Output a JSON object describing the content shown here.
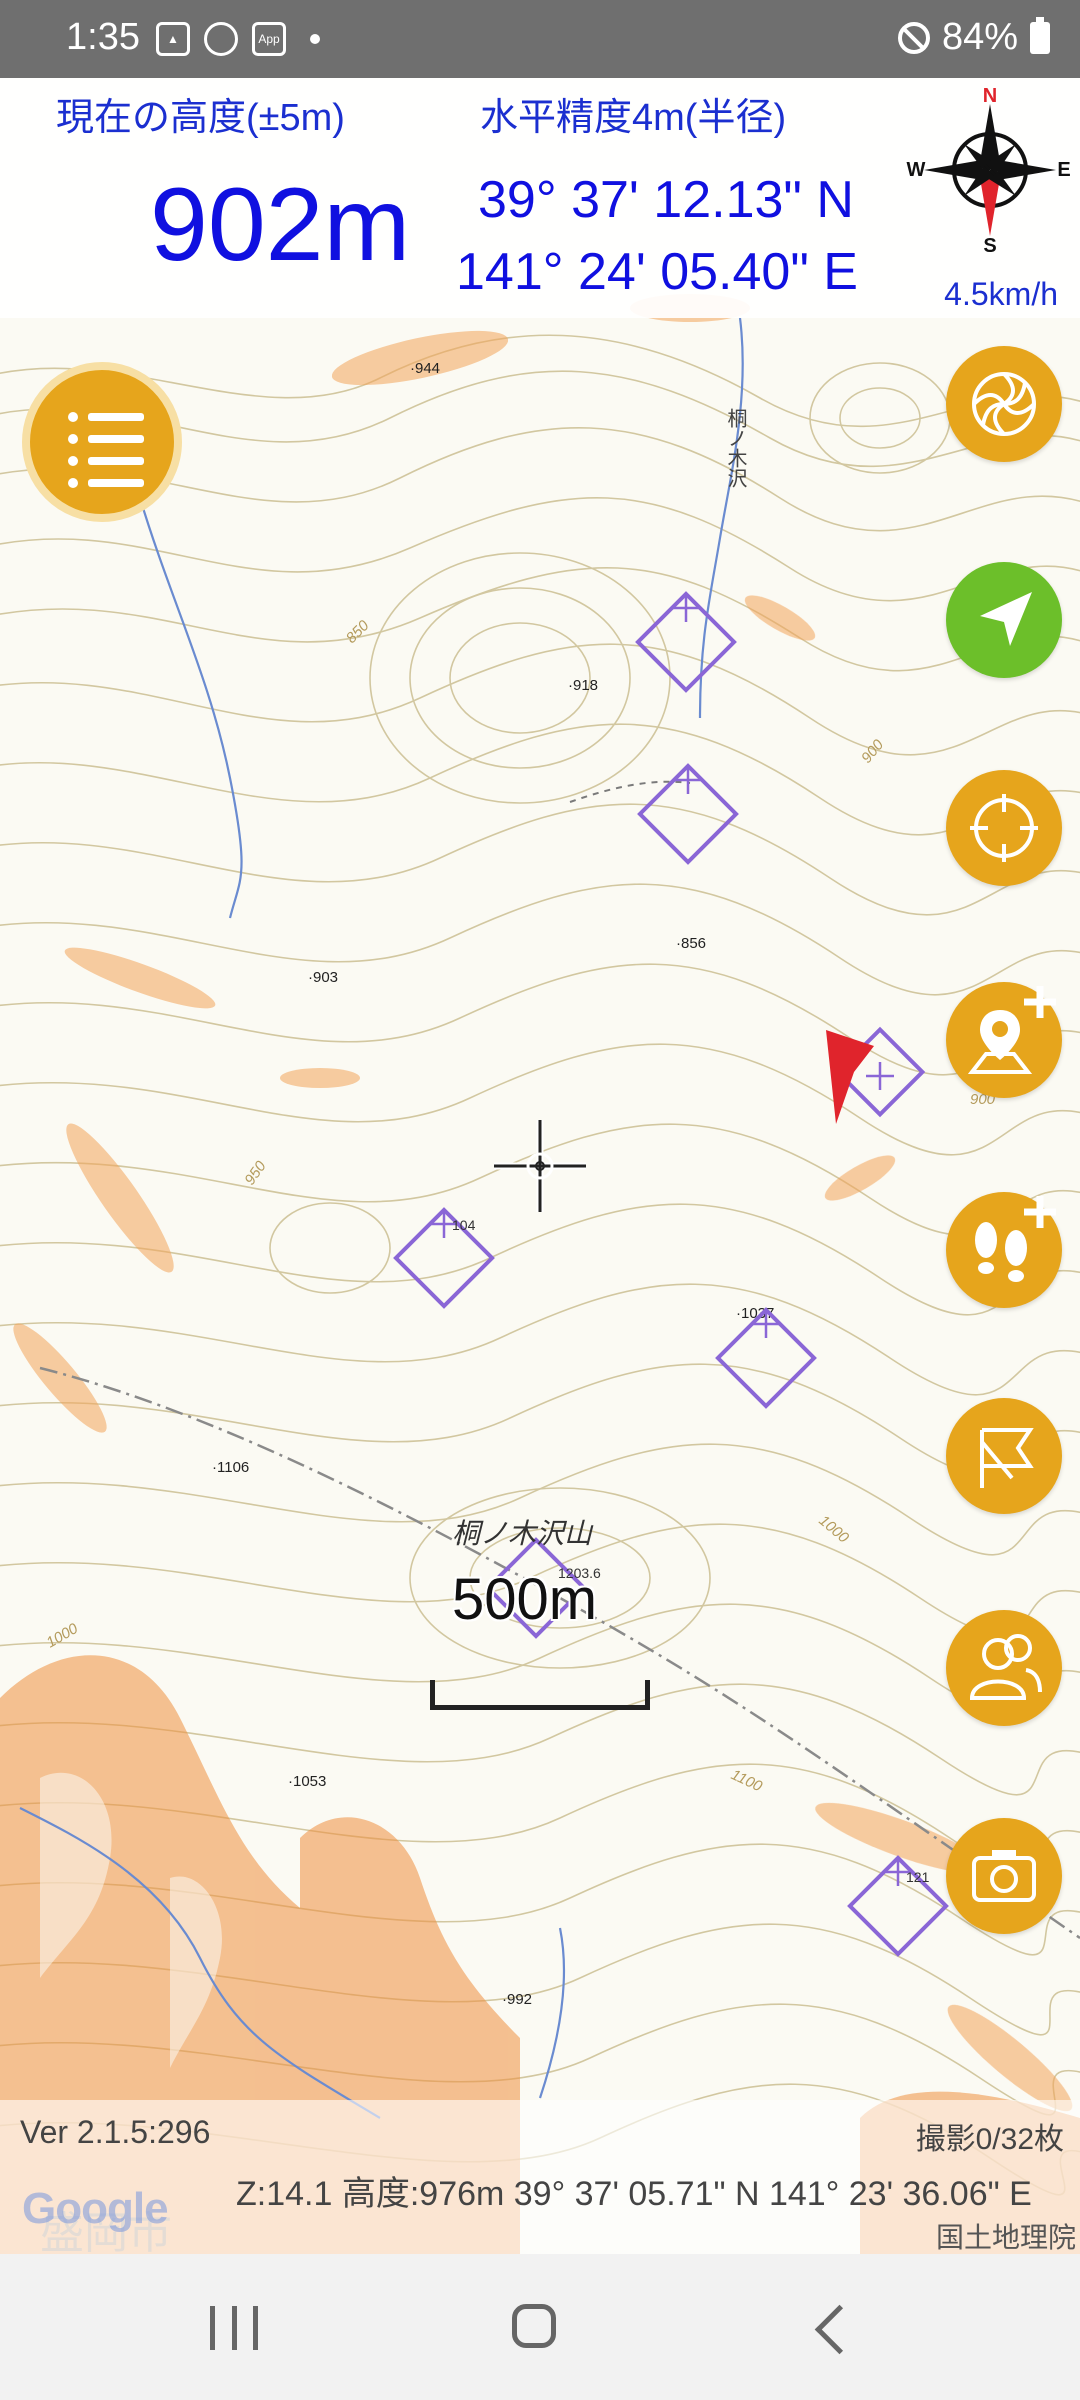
{
  "status_bar": {
    "time": "1:35",
    "app_icon_text": "App",
    "battery": "84%",
    "icons": [
      "gallery-icon",
      "chrome-icon",
      "app-icon",
      "notification-dot",
      "do-not-disturb-icon",
      "battery-icon"
    ]
  },
  "header": {
    "altitude_label": "現在の高度(±5m)",
    "accuracy_label": "水平精度4m(半径)",
    "altitude_value": "902m",
    "latitude": "39° 37' 12.13\" N",
    "longitude": "141° 24' 05.40\" E",
    "speed": "4.5km/h",
    "compass": {
      "n": "N",
      "e": "E",
      "s": "S",
      "w": "W"
    }
  },
  "map": {
    "spot_heights": [
      "944",
      "918",
      "856",
      "903",
      "1037",
      "1106",
      "1053",
      "992",
      "900",
      "850",
      "950",
      "1000",
      "1100"
    ],
    "waypoint_labels": [
      "104",
      "1203.6",
      "121"
    ],
    "place_names": [
      "桐ノ木沢",
      "桐ノ木沢山",
      "盛岡市"
    ],
    "scale_label": "500m",
    "colors": {
      "contour": "#c8b98a",
      "slope": "#f0a050",
      "waypoint": "#8a66d6",
      "stream": "#6a8bd0"
    }
  },
  "buttons": {
    "menu": "menu-icon",
    "right_column": [
      "layer-icon",
      "navigate-icon",
      "locate-icon",
      "add-place-icon",
      "add-track-icon",
      "route-flag-icon",
      "group-icon",
      "camera-icon"
    ]
  },
  "bottom": {
    "version": "Ver 2.1.5:296",
    "photos": "撮影0/32枚",
    "zoom_info": "Z:14.1 高度:976m  39° 37' 05.71\" N 141° 23' 36.06\" E",
    "google": "Google",
    "gsi": "国土地理院"
  }
}
